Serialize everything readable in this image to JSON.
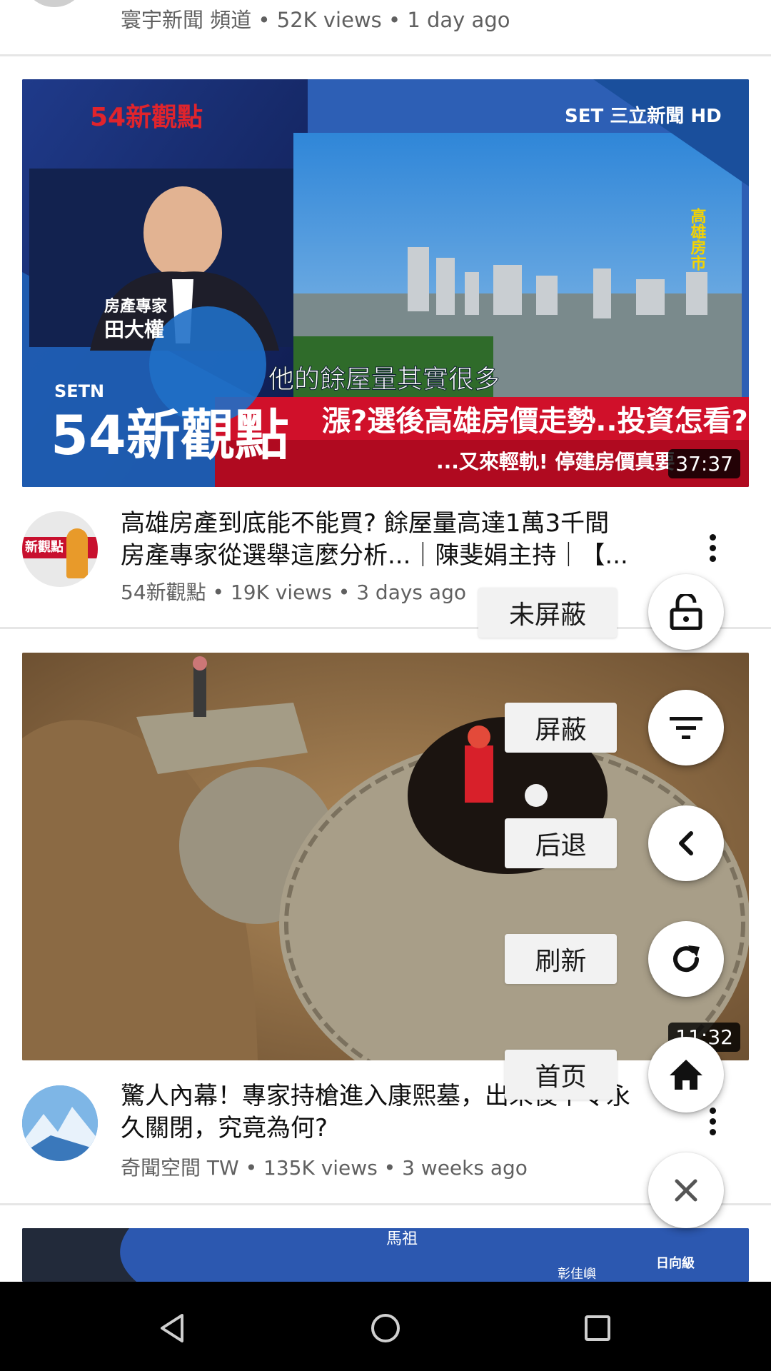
{
  "feed": {
    "top_item": {
      "meta": "寰宇新聞 頻道 • 52K views • 1 day ago"
    },
    "video1": {
      "thumbnail_text": {
        "logo": "54新觀點",
        "brand": "SET 三立新聞 HD",
        "expert_caption": "房產專家",
        "expert_name": "田大權",
        "show_big": "54新觀點",
        "setn": "SETN",
        "side_caption": "高雄房市",
        "subtitle": "他的餘屋量其實很多",
        "headline": "漲?選後高雄房價走勢..投資怎看?",
        "ticker": "...又來輕軌! 停建房價真要"
      },
      "duration": "37:37",
      "avatar_text": "新觀點",
      "title_line1": "高雄房產到底能不能買? 餘屋量高達1萬3千間",
      "title_line2": "房產專家從選舉這麼分析...｜陳斐娟主持｜【...",
      "meta": "54新觀點 • 19K views • 3 days ago"
    },
    "video2": {
      "duration": "11:32",
      "title_line1": "驚人內幕！專家持槍進入康熙墓，出來後下令永",
      "title_line2": "久關閉，究竟為何?",
      "meta": "奇聞空間 TW • 135K views • 3 weeks ago"
    },
    "video3": {
      "thumbnail_text": {
        "place1": "馬祖",
        "place2": "彰佳嶼",
        "badge": "日向級"
      }
    }
  },
  "float_menu": {
    "unblocked_label": "未屏蔽",
    "block_label": "屏蔽",
    "back_label": "后退",
    "refresh_label": "刷新",
    "home_label": "首页",
    "icons": [
      "lock-open-icon",
      "filter-icon",
      "chevron-left-icon",
      "refresh-icon",
      "home-icon",
      "close-icon"
    ]
  },
  "system_nav": {
    "icons": [
      "back-triangle-icon",
      "home-circle-icon",
      "recents-square-icon"
    ]
  },
  "colors": {
    "nav_bar": "#000000",
    "meta_text": "#606060",
    "fab_bg": "#ffffff",
    "label_bg": "#f2f2f2",
    "headline_red": "#d0102a"
  }
}
